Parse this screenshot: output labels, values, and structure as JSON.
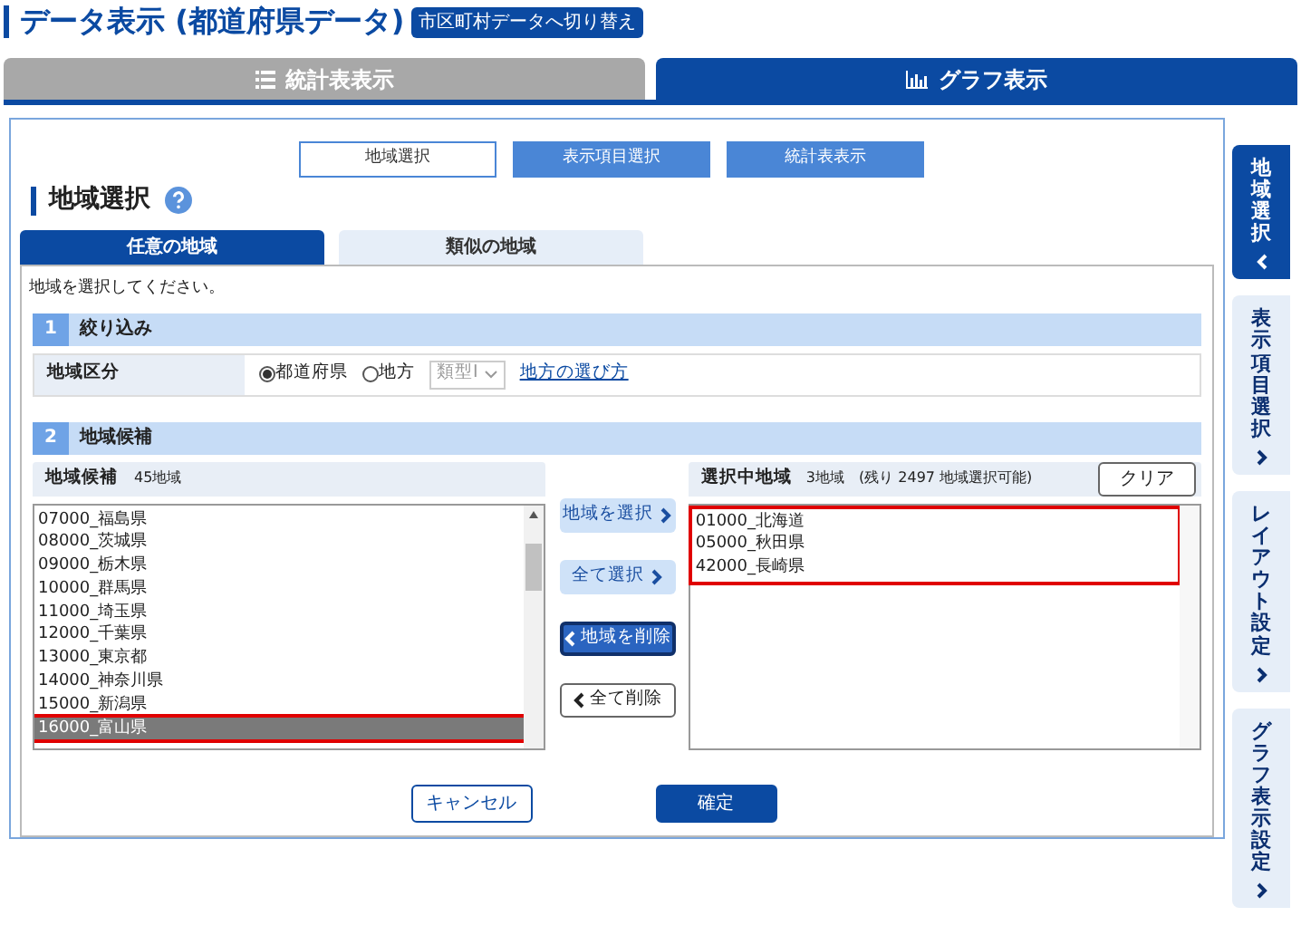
{
  "header": {
    "title": "データ表示 (都道府県データ)",
    "switch_button": "市区町村データへ切り替え"
  },
  "view_tabs": [
    {
      "label": "統計表表示",
      "kind": "table",
      "selected": false
    },
    {
      "label": "グラフ表示",
      "kind": "graph",
      "selected": true
    }
  ],
  "steps": [
    {
      "label": "地域選択",
      "selected": true
    },
    {
      "label": "表示項目選択",
      "selected": false
    },
    {
      "label": "統計表表示",
      "selected": false
    }
  ],
  "section_title": "地域選択",
  "region_tabs": [
    {
      "label": "任意の地域",
      "selected": true
    },
    {
      "label": "類似の地域",
      "selected": false
    }
  ],
  "instruction": "地域を選択してください。",
  "filter": {
    "number": "1",
    "title": "絞り込み",
    "row_label": "地域区分",
    "radios": [
      {
        "label": "都道府県",
        "selected": true
      },
      {
        "label": "地方",
        "selected": false
      }
    ],
    "select": {
      "value": "類型Ⅰ",
      "disabled": true
    },
    "link": "地方の選び方"
  },
  "candidates_section": {
    "number": "2",
    "title": "地域候補"
  },
  "candidates": {
    "title": "地域候補",
    "count": "45地域",
    "items": [
      {
        "label": "07000_福島県",
        "selected": false,
        "highlighted": false
      },
      {
        "label": "08000_茨城県",
        "selected": false,
        "highlighted": false
      },
      {
        "label": "09000_栃木県",
        "selected": false,
        "highlighted": false
      },
      {
        "label": "10000_群馬県",
        "selected": false,
        "highlighted": false
      },
      {
        "label": "11000_埼玉県",
        "selected": false,
        "highlighted": false
      },
      {
        "label": "12000_千葉県",
        "selected": false,
        "highlighted": false
      },
      {
        "label": "13000_東京都",
        "selected": false,
        "highlighted": false
      },
      {
        "label": "14000_神奈川県",
        "selected": false,
        "highlighted": false
      },
      {
        "label": "15000_新潟県",
        "selected": false,
        "highlighted": false
      },
      {
        "label": "16000_富山県",
        "selected": true,
        "highlighted": true
      }
    ]
  },
  "move_buttons": [
    {
      "label": "地域を選択",
      "kind": "add"
    },
    {
      "label": "全て選択",
      "kind": "add"
    },
    {
      "label": "地域を削除",
      "kind": "remove-active"
    },
    {
      "label": "全て削除",
      "kind": "remove"
    }
  ],
  "selected_regions": {
    "title": "選択中地域",
    "count": "3地域",
    "remaining": "(残り 2497 地域選択可能)",
    "clear_button": "クリア",
    "highlighted": true,
    "items": [
      "01000_北海道",
      "05000_秋田県",
      "42000_長崎県"
    ]
  },
  "footer_buttons": [
    {
      "label": "キャンセル",
      "kind": "secondary"
    },
    {
      "label": "確定",
      "kind": "primary"
    }
  ],
  "side_tabs": [
    {
      "label": "地域選択",
      "selected": true
    },
    {
      "label": "表示項目選択",
      "selected": false
    },
    {
      "label": "レイアウト設定",
      "selected": false
    },
    {
      "label": "グラフ表示設定",
      "selected": false
    }
  ]
}
